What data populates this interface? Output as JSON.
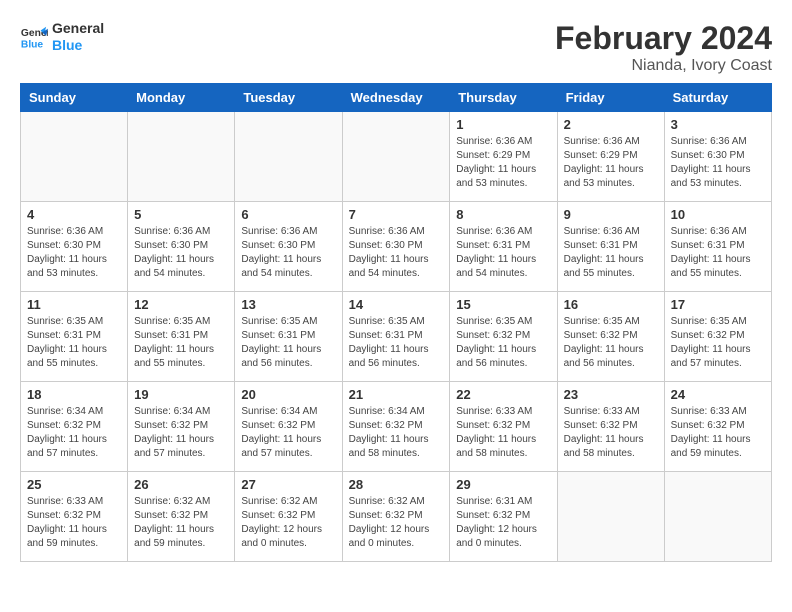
{
  "header": {
    "logo_line1": "General",
    "logo_line2": "Blue",
    "main_title": "February 2024",
    "subtitle": "Nianda, Ivory Coast"
  },
  "weekdays": [
    "Sunday",
    "Monday",
    "Tuesday",
    "Wednesday",
    "Thursday",
    "Friday",
    "Saturday"
  ],
  "weeks": [
    [
      {
        "day": "",
        "info": ""
      },
      {
        "day": "",
        "info": ""
      },
      {
        "day": "",
        "info": ""
      },
      {
        "day": "",
        "info": ""
      },
      {
        "day": "1",
        "info": "Sunrise: 6:36 AM\nSunset: 6:29 PM\nDaylight: 11 hours\nand 53 minutes."
      },
      {
        "day": "2",
        "info": "Sunrise: 6:36 AM\nSunset: 6:29 PM\nDaylight: 11 hours\nand 53 minutes."
      },
      {
        "day": "3",
        "info": "Sunrise: 6:36 AM\nSunset: 6:30 PM\nDaylight: 11 hours\nand 53 minutes."
      }
    ],
    [
      {
        "day": "4",
        "info": "Sunrise: 6:36 AM\nSunset: 6:30 PM\nDaylight: 11 hours\nand 53 minutes."
      },
      {
        "day": "5",
        "info": "Sunrise: 6:36 AM\nSunset: 6:30 PM\nDaylight: 11 hours\nand 54 minutes."
      },
      {
        "day": "6",
        "info": "Sunrise: 6:36 AM\nSunset: 6:30 PM\nDaylight: 11 hours\nand 54 minutes."
      },
      {
        "day": "7",
        "info": "Sunrise: 6:36 AM\nSunset: 6:30 PM\nDaylight: 11 hours\nand 54 minutes."
      },
      {
        "day": "8",
        "info": "Sunrise: 6:36 AM\nSunset: 6:31 PM\nDaylight: 11 hours\nand 54 minutes."
      },
      {
        "day": "9",
        "info": "Sunrise: 6:36 AM\nSunset: 6:31 PM\nDaylight: 11 hours\nand 55 minutes."
      },
      {
        "day": "10",
        "info": "Sunrise: 6:36 AM\nSunset: 6:31 PM\nDaylight: 11 hours\nand 55 minutes."
      }
    ],
    [
      {
        "day": "11",
        "info": "Sunrise: 6:35 AM\nSunset: 6:31 PM\nDaylight: 11 hours\nand 55 minutes."
      },
      {
        "day": "12",
        "info": "Sunrise: 6:35 AM\nSunset: 6:31 PM\nDaylight: 11 hours\nand 55 minutes."
      },
      {
        "day": "13",
        "info": "Sunrise: 6:35 AM\nSunset: 6:31 PM\nDaylight: 11 hours\nand 56 minutes."
      },
      {
        "day": "14",
        "info": "Sunrise: 6:35 AM\nSunset: 6:31 PM\nDaylight: 11 hours\nand 56 minutes."
      },
      {
        "day": "15",
        "info": "Sunrise: 6:35 AM\nSunset: 6:32 PM\nDaylight: 11 hours\nand 56 minutes."
      },
      {
        "day": "16",
        "info": "Sunrise: 6:35 AM\nSunset: 6:32 PM\nDaylight: 11 hours\nand 56 minutes."
      },
      {
        "day": "17",
        "info": "Sunrise: 6:35 AM\nSunset: 6:32 PM\nDaylight: 11 hours\nand 57 minutes."
      }
    ],
    [
      {
        "day": "18",
        "info": "Sunrise: 6:34 AM\nSunset: 6:32 PM\nDaylight: 11 hours\nand 57 minutes."
      },
      {
        "day": "19",
        "info": "Sunrise: 6:34 AM\nSunset: 6:32 PM\nDaylight: 11 hours\nand 57 minutes."
      },
      {
        "day": "20",
        "info": "Sunrise: 6:34 AM\nSunset: 6:32 PM\nDaylight: 11 hours\nand 57 minutes."
      },
      {
        "day": "21",
        "info": "Sunrise: 6:34 AM\nSunset: 6:32 PM\nDaylight: 11 hours\nand 58 minutes."
      },
      {
        "day": "22",
        "info": "Sunrise: 6:33 AM\nSunset: 6:32 PM\nDaylight: 11 hours\nand 58 minutes."
      },
      {
        "day": "23",
        "info": "Sunrise: 6:33 AM\nSunset: 6:32 PM\nDaylight: 11 hours\nand 58 minutes."
      },
      {
        "day": "24",
        "info": "Sunrise: 6:33 AM\nSunset: 6:32 PM\nDaylight: 11 hours\nand 59 minutes."
      }
    ],
    [
      {
        "day": "25",
        "info": "Sunrise: 6:33 AM\nSunset: 6:32 PM\nDaylight: 11 hours\nand 59 minutes."
      },
      {
        "day": "26",
        "info": "Sunrise: 6:32 AM\nSunset: 6:32 PM\nDaylight: 11 hours\nand 59 minutes."
      },
      {
        "day": "27",
        "info": "Sunrise: 6:32 AM\nSunset: 6:32 PM\nDaylight: 12 hours\nand 0 minutes."
      },
      {
        "day": "28",
        "info": "Sunrise: 6:32 AM\nSunset: 6:32 PM\nDaylight: 12 hours\nand 0 minutes."
      },
      {
        "day": "29",
        "info": "Sunrise: 6:31 AM\nSunset: 6:32 PM\nDaylight: 12 hours\nand 0 minutes."
      },
      {
        "day": "",
        "info": ""
      },
      {
        "day": "",
        "info": ""
      }
    ]
  ]
}
